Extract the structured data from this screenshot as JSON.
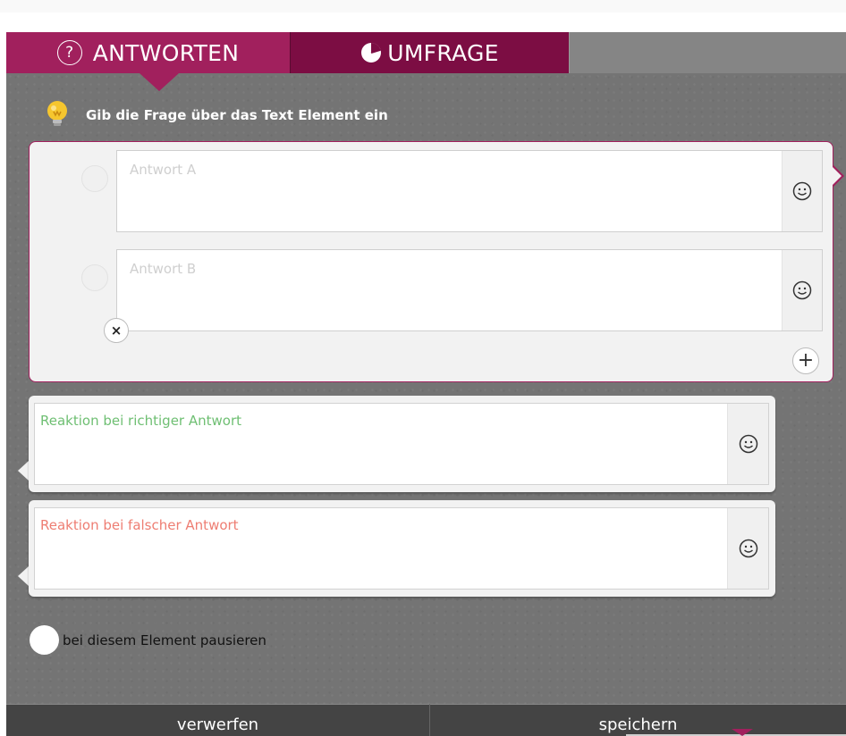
{
  "tabs": {
    "antworten": {
      "label": "ANTWORTEN",
      "icon": "question-circle-icon"
    },
    "umfrage": {
      "label": "UMFRAGE",
      "icon": "pie-chart-icon"
    }
  },
  "hint": {
    "icon": "lightbulb-icon",
    "text": "Gib die Frage über das Text Element ein"
  },
  "answers": [
    {
      "placeholder": "Antwort A",
      "emoji_icon": "smiley-icon"
    },
    {
      "placeholder": "Antwort B",
      "emoji_icon": "smiley-icon"
    }
  ],
  "remove_answer": {
    "label": "×"
  },
  "add_answer": {
    "label": "+"
  },
  "reactions": {
    "correct": {
      "placeholder": "Reaktion bei richtiger Antwort",
      "color": "#6fbf73"
    },
    "wrong": {
      "placeholder": "Reaktion bei falscher Antwort",
      "color": "#ee7d72"
    }
  },
  "pause": {
    "label": "bei diesem Element pausieren",
    "checked": false
  },
  "buttons": {
    "discard": "verwerfen",
    "save": "speichern"
  },
  "colors": {
    "accent": "#a1205d",
    "accent_dark": "#7c0d43"
  }
}
